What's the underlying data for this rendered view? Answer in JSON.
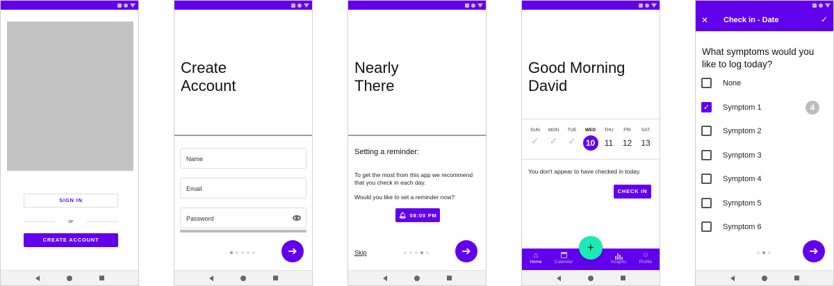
{
  "colors": {
    "primary": "#6200ee",
    "teal": "#1de9b6"
  },
  "screen1": {
    "sign_in": "SIGN IN",
    "or": "or",
    "create_account": "CREATE ACCOUNT"
  },
  "screen2": {
    "title_line1": "Create",
    "title_line2": "Account",
    "name_placeholder": "Name",
    "email_placeholder": "Email",
    "password_placeholder": "Password",
    "eye_icon": "eye-icon"
  },
  "screen3": {
    "title_line1": "Nearly",
    "title_line2": "There",
    "heading": "Setting a reminder:",
    "body1": "To get the most from this app we recommend that you check in each day.",
    "body2": "Would you like to set a reminder now?",
    "reminder_time": "08:00 PM",
    "skip": "Skip"
  },
  "screen4": {
    "greeting_line1": "Good Morning",
    "greeting_line2": "David",
    "days": [
      {
        "name": "SUN",
        "date": ""
      },
      {
        "name": "MON",
        "date": ""
      },
      {
        "name": "TUE",
        "date": ""
      },
      {
        "name": "WED",
        "date": "10"
      },
      {
        "name": "THU",
        "date": "11"
      },
      {
        "name": "FRI",
        "date": "12"
      },
      {
        "name": "SAT",
        "date": "13"
      }
    ],
    "not_checked_in": "You don't appear to have checked in today.",
    "check_in": "CHECK IN",
    "fab": "+",
    "tabs": [
      "Home",
      "Calendar",
      "",
      "Insights",
      "Profile"
    ]
  },
  "screen5": {
    "appbar_title": "Check in - Date",
    "question_line1": "What symptoms would you",
    "question_line2": "like to log today?",
    "options": [
      {
        "label": "None",
        "checked": false
      },
      {
        "label": "Symptom 1",
        "checked": true
      },
      {
        "label": "Symptom 2",
        "checked": false
      },
      {
        "label": "Symptom 3",
        "checked": false
      },
      {
        "label": "Symptom 4",
        "checked": false
      },
      {
        "label": "Symptom 5",
        "checked": false
      },
      {
        "label": "Symptom 6",
        "checked": false
      }
    ],
    "badge": "4"
  }
}
